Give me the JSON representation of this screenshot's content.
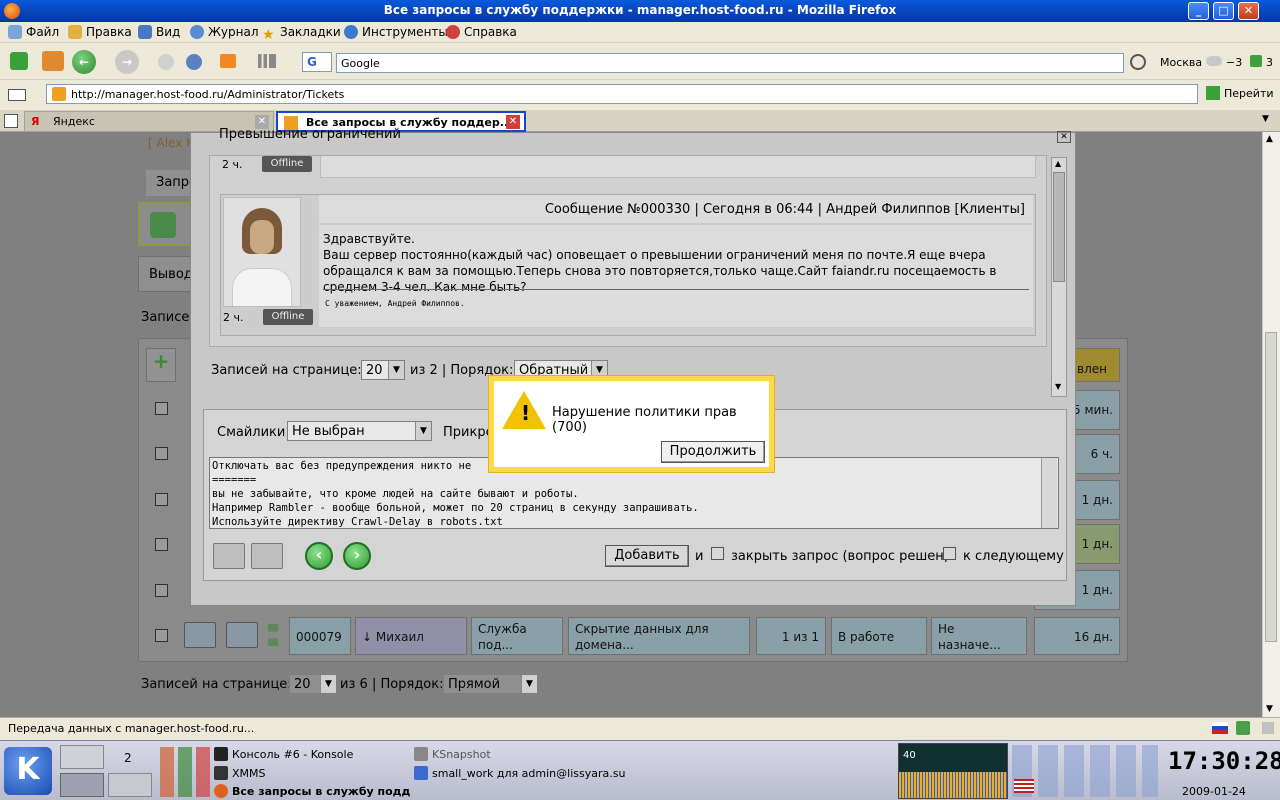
{
  "window": {
    "title": "Все запросы в службу поддержки - manager.host-food.ru - Mozilla Firefox",
    "controls": [
      "_",
      "□",
      "✕"
    ]
  },
  "menu": [
    {
      "label": "Файл",
      "icon": "file-icon"
    },
    {
      "label": "Правка",
      "icon": "edit-icon"
    },
    {
      "label": "Вид",
      "icon": "view-icon"
    },
    {
      "label": "Журнал",
      "icon": "history-icon"
    },
    {
      "label": "Закладки",
      "icon": "star-icon"
    },
    {
      "label": "Инструменты",
      "icon": "tools-icon"
    },
    {
      "label": "Справка",
      "icon": "help-icon"
    }
  ],
  "search": {
    "value": "Google",
    "engine": "G"
  },
  "weather": {
    "city": "Москва",
    "temp": "−3",
    "count": "3"
  },
  "address": {
    "url": "http://manager.host-food.ru/Administrator/Tickets",
    "lang": "En",
    "go": "Перейти"
  },
  "tabs": [
    {
      "label": "Яндекс",
      "active": false
    },
    {
      "label": "Все запросы в службу поддер...",
      "active": true
    }
  ],
  "bg": {
    "user_bracket": "[ Alex K",
    "tab_label": "Запро",
    "filter_label": "Вывод",
    "records_label": "Записей",
    "records_per_page": "Записей на странице:",
    "per_page": "20",
    "of_pages": "из 6",
    "order_label": "| Порядок:",
    "order": "Прямой",
    "rows": [
      {
        "right": "5 мин."
      },
      {
        "right": "6 ч."
      },
      {
        "right": "1 дн."
      },
      {
        "right": "1 дн."
      },
      {
        "right": "1 дн."
      },
      {
        "id": "000079",
        "user": "Михаил",
        "dept": "Служба под...",
        "subject": "Скрытие данных для домена...",
        "msgs": "1 из 1",
        "status": "В работе",
        "assignee": "Не назначе...",
        "right": "16 дн."
      }
    ],
    "header_right": "влен"
  },
  "modal": {
    "title": "Превышение ограничений",
    "msg1": {
      "time": "2 ч.",
      "status": "Offline"
    },
    "msg2": {
      "header": "Сообщение №000330 | Сегодня в 06:44 | Андрей Филиппов [Клиенты]",
      "body": "Здравствуйте.\nВаш сервер постоянно(каждый час) оповещает о превышении ограничений меня по почте.Я еще вчера обращался к вам за помощью.Теперь снова это повторяется,только чаще.Сайт faiandr.ru посещаемость в среднем 3-4 чел. Как мне быть?",
      "signature": "С уважением, Андрей Филиппов.",
      "time": "2 ч.",
      "status": "Offline"
    },
    "pager": {
      "label": "Записей на странице:",
      "value": "20",
      "of": "из 2 | Порядок:",
      "order": "Обратный"
    },
    "smileys_label": "Смайлики",
    "smileys_value": "Не выбран",
    "attach_label": "Прикре",
    "reply": "Отключать вас без предупреждения никто не\n=======\nвы не забывайте, что кроме людей на сайте бывают и роботы.\nНапример Rambler - вообще больной, может по 20 страниц в секунду запрашивать.\nИспользуйте директиву Crawl-Delay в robots.txt",
    "add_button": "Добавить",
    "and": "и",
    "close_label": "закрыть запрос (вопрос решен)",
    "next_label": "к следующему"
  },
  "alert": {
    "message": "Нарушение политики прав (700)",
    "button": "Продолжить"
  },
  "status": {
    "text": "Передача данных с manager.host-food.ru..."
  },
  "taskbar": {
    "desktop": "2",
    "tasks": [
      "Консоль #6 - Konsole",
      "XMMS",
      "Все запросы в службу подде",
      "KSnapshot",
      "small_work для admin@lissyara.su"
    ],
    "graph_value": "40",
    "graph_zero": "0",
    "clock": "17:30:28",
    "date": "2009-01-24"
  },
  "colors": {
    "xp_blue": "#0a5adb",
    "alert_border": "#ffd84a",
    "page_dim": "#808080"
  }
}
